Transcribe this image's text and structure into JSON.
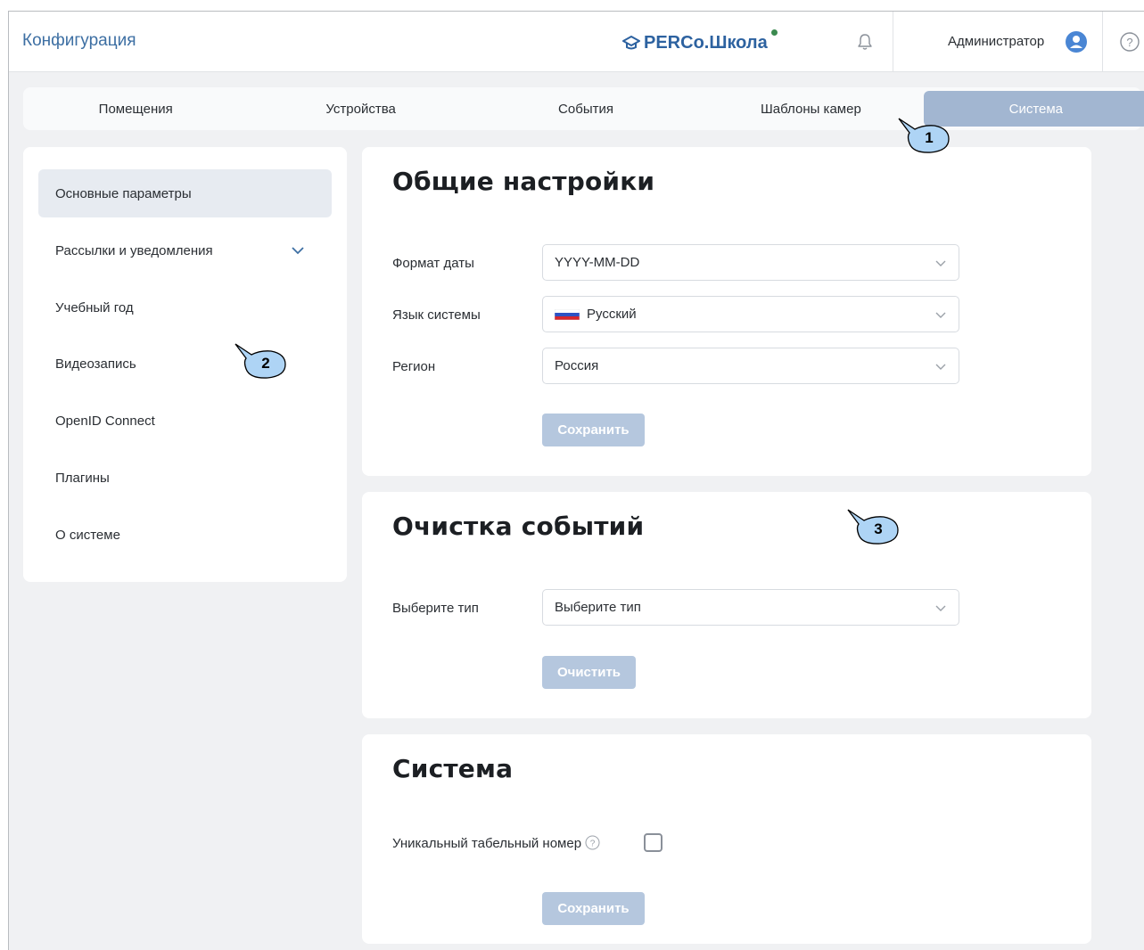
{
  "header": {
    "title": "Конфигурация",
    "logo_text": "PERCo.Школа",
    "user_name": "Администратор"
  },
  "tabs": [
    {
      "label": "Помещения",
      "active": false
    },
    {
      "label": "Устройства",
      "active": false
    },
    {
      "label": "События",
      "active": false
    },
    {
      "label": "Шаблоны камер",
      "active": false
    },
    {
      "label": "Система",
      "active": true
    }
  ],
  "callouts": [
    "1",
    "2",
    "3"
  ],
  "sidebar": {
    "items": [
      {
        "label": "Основные параметры",
        "active": true
      },
      {
        "label": "Рассылки и уведомления",
        "expandable": true
      },
      {
        "label": "Учебный год"
      },
      {
        "label": "Видеозапись"
      },
      {
        "label": "OpenID Connect"
      },
      {
        "label": "Плагины"
      },
      {
        "label": "О системе"
      }
    ]
  },
  "general_settings": {
    "title": "Общие настройки",
    "date_format_label": "Формат даты",
    "date_format_value": "YYYY-MM-DD",
    "language_label": "Язык системы",
    "language_value": "Русский",
    "region_label": "Регион",
    "region_value": "Россия",
    "save_label": "Сохранить"
  },
  "events_cleanup": {
    "title": "Очистка событий",
    "type_label": "Выберите тип",
    "type_value": "Выберите тип",
    "clear_label": "Очистить"
  },
  "system": {
    "title": "Система",
    "unique_number_label": "Уникальный табельный номер",
    "unique_number_checked": false,
    "save_label": "Сохранить"
  },
  "colors": {
    "accent": "#3d6fa3",
    "tab_active": "#a2b6d1",
    "button_disabled": "#b5c7de",
    "callout_fill": "#aed4f5"
  }
}
